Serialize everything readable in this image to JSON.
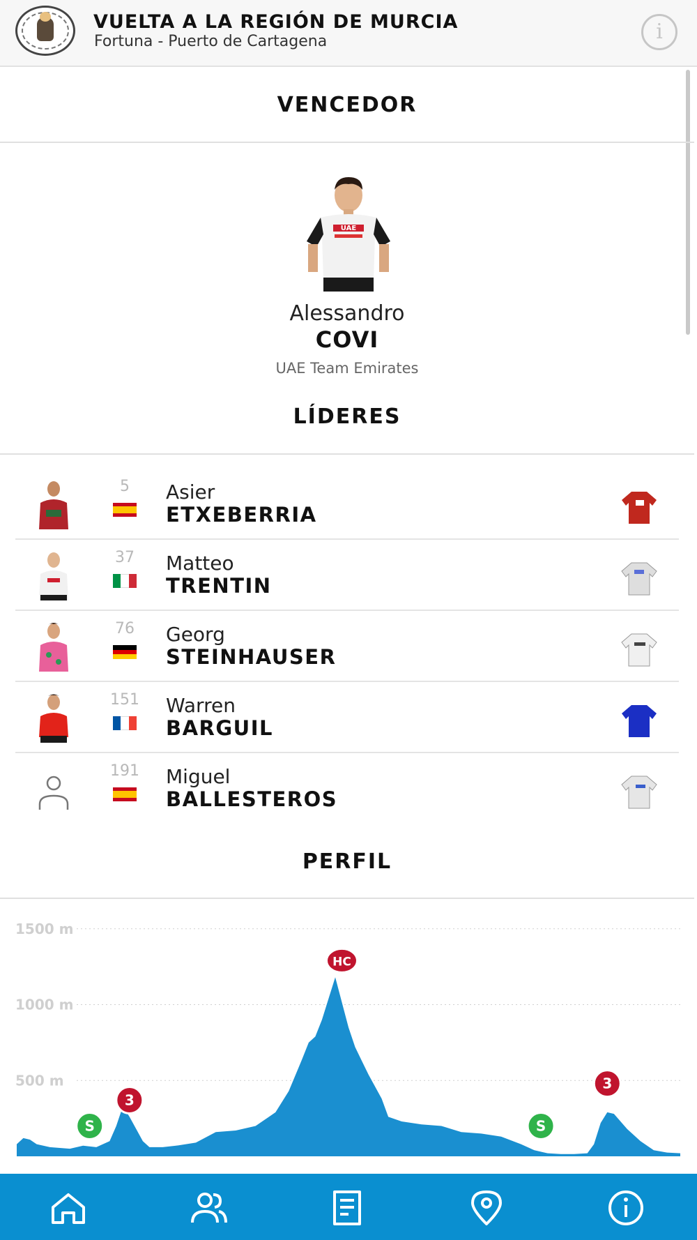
{
  "header": {
    "title": "VUELTA A LA REGIÓN DE MURCIA",
    "subtitle": "Fortuna - Puerto de Cartagena",
    "logo_icon": "race-logo",
    "info_icon": "info-icon"
  },
  "winner_section": {
    "heading": "VENCEDOR",
    "first_name": "Alessandro",
    "last_name": "COVI",
    "team": "UAE Team Emirates"
  },
  "leaders_section": {
    "heading": "LÍDERES",
    "leaders": [
      {
        "number": "5",
        "first_name": "Asier",
        "last_name": "ETXEBERRIA",
        "nationality": "Spain",
        "jersey_color": "#c0281e"
      },
      {
        "number": "37",
        "first_name": "Matteo",
        "last_name": "TRENTIN",
        "nationality": "Italy",
        "jersey_color": "#e6e6e6"
      },
      {
        "number": "76",
        "first_name": "Georg",
        "last_name": "STEINHAUSER",
        "nationality": "Germany",
        "jersey_color": "#f0f0f0"
      },
      {
        "number": "151",
        "first_name": "Warren",
        "last_name": "BARGUIL",
        "nationality": "France",
        "jersey_color": "#1b2fc4"
      },
      {
        "number": "191",
        "first_name": "Miguel",
        "last_name": "BALLESTEROS",
        "nationality": "Spain",
        "jersey_color": "#e8e8e8"
      }
    ]
  },
  "profile_section": {
    "heading": "PERFIL"
  },
  "chart_data": {
    "type": "area",
    "title": "",
    "xlabel": "",
    "ylabel": "",
    "y_ticks": [
      "1500 m",
      "1000 m",
      "500 m"
    ],
    "y_tick_values": [
      1500,
      1000,
      500
    ],
    "ylim": [
      0,
      1600
    ],
    "grid": true,
    "fill_color": "#1a8fd0",
    "x_unit": "fraction of stage",
    "x": [
      0,
      0.01,
      0.02,
      0.03,
      0.05,
      0.08,
      0.1,
      0.12,
      0.14,
      0.15,
      0.16,
      0.17,
      0.18,
      0.19,
      0.2,
      0.22,
      0.24,
      0.27,
      0.3,
      0.33,
      0.36,
      0.39,
      0.41,
      0.43,
      0.44,
      0.45,
      0.46,
      0.48,
      0.5,
      0.51,
      0.52,
      0.53,
      0.55,
      0.56,
      0.58,
      0.61,
      0.64,
      0.67,
      0.7,
      0.73,
      0.76,
      0.78,
      0.8,
      0.82,
      0.84,
      0.86,
      0.87,
      0.88,
      0.89,
      0.9,
      0.91,
      0.92,
      0.94,
      0.96,
      0.98,
      1.0
    ],
    "values": [
      80,
      120,
      110,
      80,
      60,
      50,
      70,
      60,
      100,
      200,
      330,
      260,
      180,
      100,
      60,
      60,
      70,
      90,
      160,
      170,
      200,
      290,
      430,
      640,
      750,
      790,
      900,
      1180,
      850,
      720,
      630,
      540,
      380,
      260,
      230,
      210,
      200,
      160,
      150,
      130,
      80,
      40,
      20,
      15,
      15,
      20,
      80,
      220,
      290,
      280,
      230,
      180,
      100,
      40,
      25,
      20
    ],
    "annotations": [
      {
        "label": "S",
        "type": "sprint",
        "color": "#2fb34a",
        "x": 0.11,
        "y": 200
      },
      {
        "label": "3",
        "type": "climb",
        "color": "#c0142e",
        "x": 0.17,
        "y": 370
      },
      {
        "label": "HC",
        "type": "climb",
        "color": "#c0142e",
        "x": 0.49,
        "y": 1290
      },
      {
        "label": "S",
        "type": "sprint",
        "color": "#2fb34a",
        "x": 0.79,
        "y": 200
      },
      {
        "label": "3",
        "type": "climb",
        "color": "#c0142e",
        "x": 0.89,
        "y": 480
      }
    ]
  },
  "bottom_nav": {
    "items": [
      {
        "icon": "home-icon"
      },
      {
        "icon": "riders-icon"
      },
      {
        "icon": "classification-icon"
      },
      {
        "icon": "location-icon"
      },
      {
        "icon": "info-icon"
      }
    ]
  }
}
